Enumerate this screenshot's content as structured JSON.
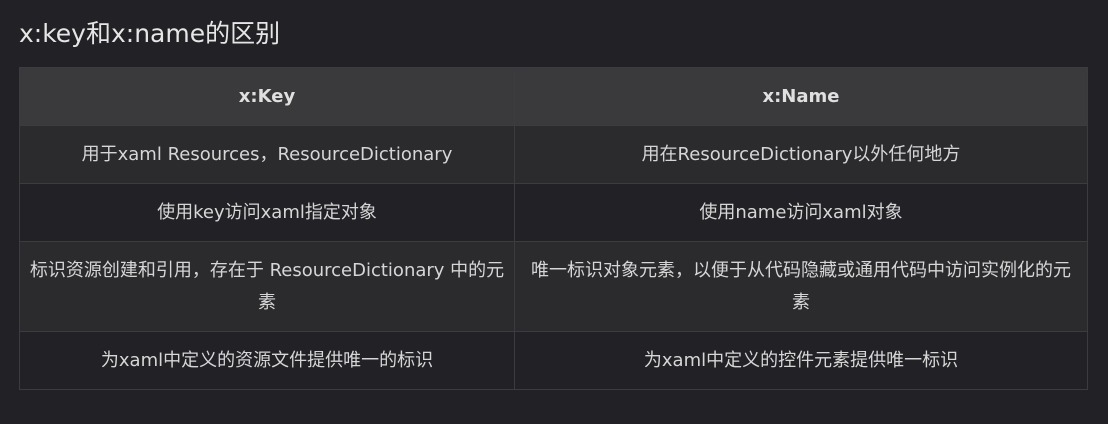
{
  "heading": "x:key和x:name的区别",
  "table": {
    "headers": [
      "x:Key",
      "x:Name"
    ],
    "rows": [
      [
        "用于xaml Resources，ResourceDictionary",
        "用在ResourceDictionary以外任何地方"
      ],
      [
        "使用key访问xaml指定对象",
        "使用name访问xaml对象"
      ],
      [
        "标识资源创建和引用，存在于 ResourceDictionary 中的元素",
        "唯一标识对象元素，以便于从代码隐藏或通用代码中访问实例化的元素"
      ],
      [
        "为xaml中定义的资源文件提供唯一的标识",
        "为xaml中定义的控件元素提供唯一标识"
      ]
    ]
  }
}
